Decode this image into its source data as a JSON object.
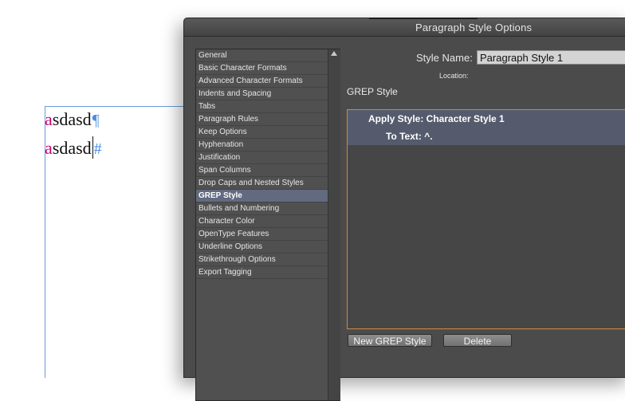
{
  "document": {
    "lines": [
      {
        "first": "a",
        "rest": "sdasd",
        "mark": "¶"
      },
      {
        "first": "a",
        "rest": "sdasd",
        "mark": "#"
      }
    ]
  },
  "dialog": {
    "title": "Paragraph Style Options",
    "categories": [
      "General",
      "Basic Character Formats",
      "Advanced Character Formats",
      "Indents and Spacing",
      "Tabs",
      "Paragraph Rules",
      "Keep Options",
      "Hyphenation",
      "Justification",
      "Span Columns",
      "Drop Caps and Nested Styles",
      "GREP Style",
      "Bullets and Numbering",
      "Character Color",
      "OpenType Features",
      "Underline Options",
      "Strikethrough Options",
      "Export Tagging"
    ],
    "selected_category": "GREP Style",
    "style_name_label": "Style Name:",
    "style_name_value": "Paragraph Style 1",
    "location_label": "Location:",
    "section_title": "GREP Style",
    "rule": {
      "apply_style": "Apply Style: Character Style 1",
      "to_text": "To Text: ^."
    },
    "buttons": {
      "new_grep_style": "New GREP Style",
      "delete": "Delete"
    }
  },
  "colors": {
    "accent_pink": "#c8007a",
    "hidden_char_blue": "#4a8fe0",
    "panel_orange_border": "#d18a3c",
    "selection": "#626a80"
  }
}
